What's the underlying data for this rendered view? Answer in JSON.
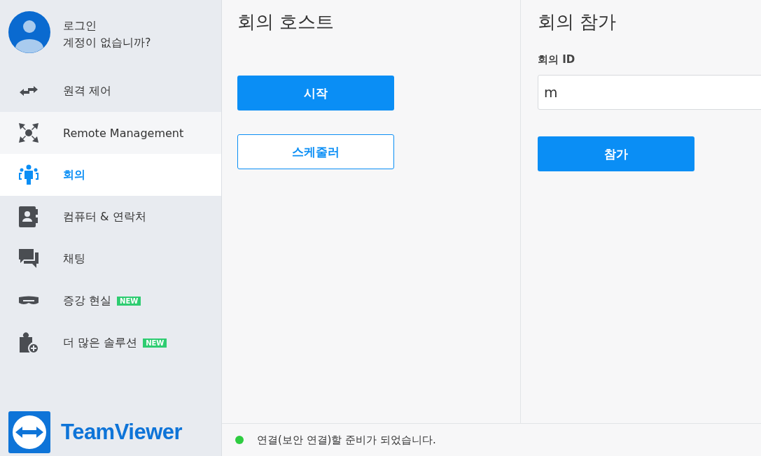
{
  "account": {
    "login": "로그인",
    "signup": "계정이 없습니까?"
  },
  "nav": [
    {
      "label": "원격 제어",
      "selected": false,
      "hovered": false
    },
    {
      "label": "Remote Management",
      "selected": false,
      "hovered": true
    },
    {
      "label": "회의",
      "selected": true,
      "hovered": false
    },
    {
      "label": "컴퓨터 & 연락처",
      "selected": false,
      "hovered": false
    },
    {
      "label": "채팅",
      "selected": false,
      "hovered": false
    },
    {
      "label": "증강 현실",
      "selected": false,
      "hovered": false,
      "badge": "NEW"
    },
    {
      "label": "더 많은 솔루션",
      "selected": false,
      "hovered": false,
      "badge": "NEW"
    }
  ],
  "brand": "TeamViewer",
  "host": {
    "title": "회의 호스트",
    "start": "시작",
    "scheduler": "스케줄러"
  },
  "join": {
    "title": "회의 참가",
    "id_label": "회의 ID",
    "id_value": "m",
    "join": "참가"
  },
  "status": {
    "text": "연결(보안 연결)할 준비가 되었습니다.",
    "color": "#2ecc40"
  }
}
